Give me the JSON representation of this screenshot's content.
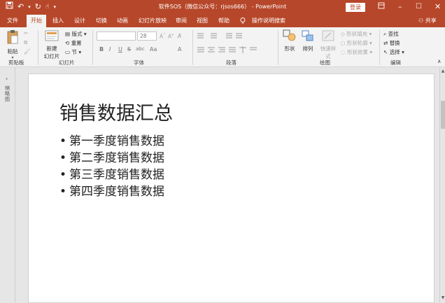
{
  "titlebar": {
    "title": "软件SOS（微信公众号：rjsos666） - PowerPoint",
    "login_label": "登录",
    "qat": [
      "save-icon",
      "undo-icon",
      "redo-icon",
      "touch-mode-icon",
      "customize-icon"
    ]
  },
  "tabs": [
    "文件",
    "开始",
    "插入",
    "设计",
    "切换",
    "动画",
    "幻灯片放映",
    "审阅",
    "视图",
    "帮助"
  ],
  "tell_me": "操作说明搜索",
  "share": "共享",
  "ribbon": {
    "clipboard": {
      "paste": "粘贴",
      "group": "剪贴板"
    },
    "slides": {
      "new_slide_1": "新建",
      "new_slide_2": "幻灯片",
      "layout": "版式",
      "reset": "重置",
      "section": "节",
      "group": "幻灯片"
    },
    "font": {
      "font_name": "",
      "font_size": "28",
      "group": "字体",
      "bold": "B",
      "italic": "I",
      "underline": "U",
      "strike": "S",
      "spacing": "abc",
      "case": "Aa",
      "grow": "A",
      "shrink": "A",
      "clear": "A",
      "color": "A"
    },
    "paragraph": {
      "group": "段落"
    },
    "drawing": {
      "shapes": "形状",
      "arrange": "排列",
      "quick_styles": "快速样式",
      "fill": "形状填充",
      "outline": "形状轮廓",
      "effect": "形状效果",
      "group": "绘图"
    },
    "editing": {
      "find": "查找",
      "replace": "替换",
      "select": "选择",
      "group": "编辑"
    }
  },
  "thumbnail_pane": {
    "label": "缩略图"
  },
  "slide": {
    "title": "销售数据汇总",
    "bullets": [
      "第一季度销售数据",
      "第二季度销售数据",
      "第三季度销售数据",
      "第四季度销售数据"
    ]
  },
  "colors": {
    "accent": "#b7472a",
    "ribbon_bg": "#f3f3f3",
    "workspace_bg": "#e6e6e6"
  }
}
